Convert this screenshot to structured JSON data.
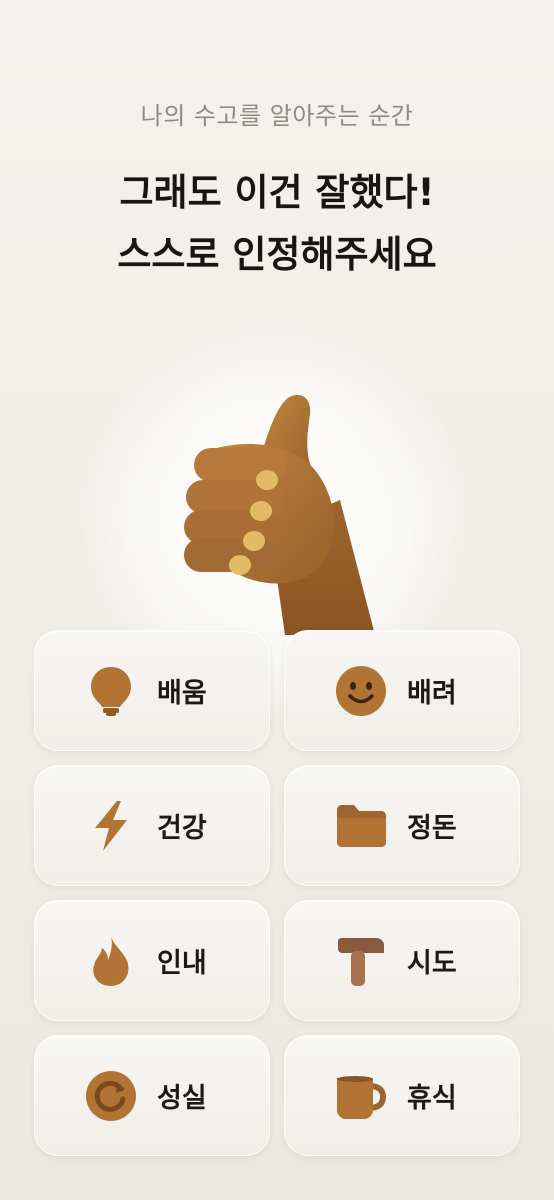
{
  "header": {
    "subtitle": "나의 수고를 알아주는 순간",
    "title_line1": "그래도 이건 잘했다!",
    "title_line2": "스스로 인정해주세요"
  },
  "hero": {
    "icon": "thumbs-up-icon"
  },
  "colors": {
    "accent": "#b27434",
    "background": "#f0ede7",
    "text": "#181512"
  },
  "categories": [
    {
      "label": "배움",
      "icon": "lightbulb-icon"
    },
    {
      "label": "배려",
      "icon": "smiley-icon"
    },
    {
      "label": "건강",
      "icon": "lightning-icon"
    },
    {
      "label": "정돈",
      "icon": "folder-icon"
    },
    {
      "label": "인내",
      "icon": "flame-icon"
    },
    {
      "label": "시도",
      "icon": "hammer-icon"
    },
    {
      "label": "성실",
      "icon": "refresh-icon"
    },
    {
      "label": "휴식",
      "icon": "mug-icon"
    }
  ]
}
